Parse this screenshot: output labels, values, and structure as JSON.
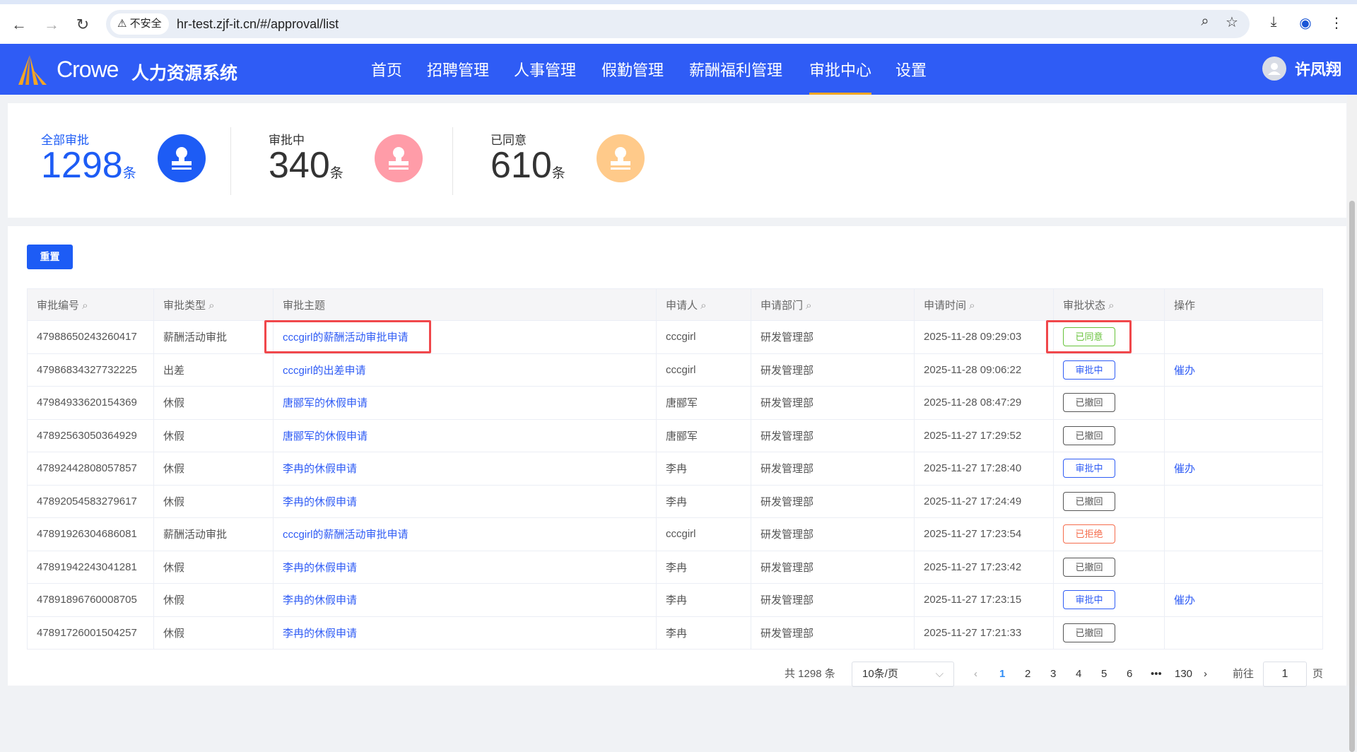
{
  "browser": {
    "security": "不安全",
    "url": "hr-test.zjf-it.cn/#/approval/list"
  },
  "header": {
    "brand": "Crowe",
    "system": "人力资源系统",
    "nav": [
      "首页",
      "招聘管理",
      "人事管理",
      "假勤管理",
      "薪酬福利管理",
      "审批中心",
      "设置"
    ],
    "active": "审批中心",
    "user": "许凤翔"
  },
  "stats": [
    {
      "label": "全部审批",
      "value": "1298",
      "unit": "条",
      "color": "#1d5cf5"
    },
    {
      "label": "审批中",
      "value": "340",
      "unit": "条",
      "color": "#ff9ca8"
    },
    {
      "label": "已同意",
      "value": "610",
      "unit": "条",
      "color": "#ffca8a"
    }
  ],
  "reset_label": "重置",
  "table": {
    "headers": [
      "审批编号",
      "审批类型",
      "审批主题",
      "申请人",
      "申请部门",
      "申请时间",
      "审批状态",
      "操作"
    ],
    "rows": [
      [
        "47988650243260417",
        "薪酬活动审批",
        "cccgirl的薪酬活动审批申请",
        "cccgirl",
        "研发管理部",
        "2025-11-28 09:29:03",
        "已同意",
        ""
      ],
      [
        "47986834327732225",
        "出差",
        "cccgirl的出差申请",
        "cccgirl",
        "研发管理部",
        "2025-11-28 09:06:22",
        "审批中",
        "催办"
      ],
      [
        "47984933620154369",
        "休假",
        "唐郦军的休假申请",
        "唐郦军",
        "研发管理部",
        "2025-11-28 08:47:29",
        "已撤回",
        ""
      ],
      [
        "47892563050364929",
        "休假",
        "唐郦军的休假申请",
        "唐郦军",
        "研发管理部",
        "2025-11-27 17:29:52",
        "已撤回",
        ""
      ],
      [
        "47892442808057857",
        "休假",
        "李冉的休假申请",
        "李冉",
        "研发管理部",
        "2025-11-27 17:28:40",
        "审批中",
        "催办"
      ],
      [
        "47892054583279617",
        "休假",
        "李冉的休假申请",
        "李冉",
        "研发管理部",
        "2025-11-27 17:24:49",
        "已撤回",
        ""
      ],
      [
        "47891926304686081",
        "薪酬活动审批",
        "cccgirl的薪酬活动审批申请",
        "cccgirl",
        "研发管理部",
        "2025-11-27 17:23:54",
        "已拒绝",
        ""
      ],
      [
        "47891942243041281",
        "休假",
        "李冉的休假申请",
        "李冉",
        "研发管理部",
        "2025-11-27 17:23:42",
        "已撤回",
        ""
      ],
      [
        "47891896760008705",
        "休假",
        "李冉的休假申请",
        "李冉",
        "研发管理部",
        "2025-11-27 17:23:15",
        "审批中",
        "催办"
      ],
      [
        "47891726001504257",
        "休假",
        "李冉的休假申请",
        "李冉",
        "研发管理部",
        "2025-11-27 17:21:33",
        "已撤回",
        ""
      ]
    ]
  },
  "status_colors": {
    "已同意": "#67c23a",
    "审批中": "#2f5cf5",
    "已撤回": "#555555",
    "已拒绝": "#f56c4c"
  },
  "pagination": {
    "total": "共 1298 条",
    "page_size": "10条/页",
    "pages": [
      "1",
      "2",
      "3",
      "4",
      "5",
      "6",
      "•••",
      "130"
    ],
    "current": "1",
    "goto_label": "前往",
    "goto_value": "1",
    "page_suffix": "页"
  }
}
